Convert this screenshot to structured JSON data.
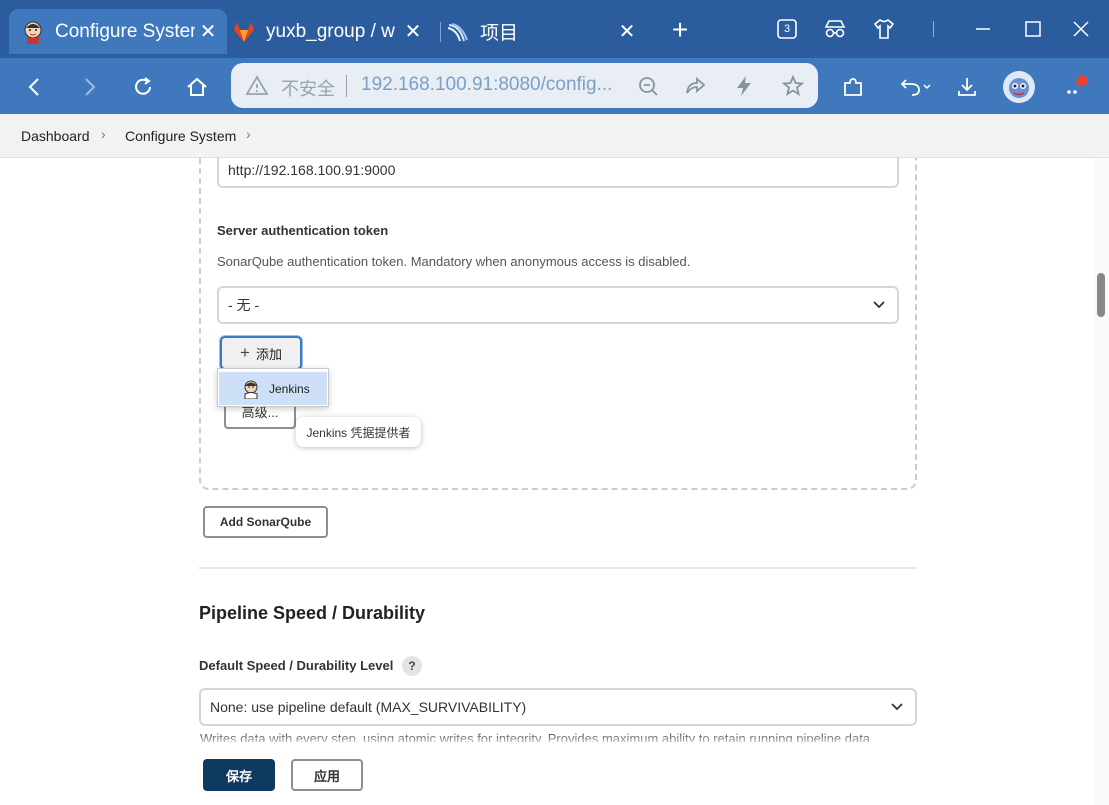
{
  "browser": {
    "tabs": [
      {
        "title": "Configure System",
        "icon": "jenkins-icon"
      },
      {
        "title": "yuxb_group / w",
        "icon": "gitlab-icon"
      },
      {
        "title": "项目",
        "icon": "project-icon"
      }
    ],
    "tab_count_badge": "3",
    "address": {
      "insecure_label": "不安全",
      "url": "192.168.100.91:8080/config..."
    }
  },
  "breadcrumb": {
    "items": [
      "Dashboard",
      "Configure System"
    ]
  },
  "sonar": {
    "server_url_value": "http://192.168.100.91:9000",
    "token_label": "Server authentication token",
    "token_desc": "SonarQube authentication token. Mandatory when anonymous access is disabled.",
    "token_select_value": "- 无 -",
    "add_button": "添加",
    "add_menu_item": "Jenkins",
    "advanced_button": "高级...",
    "tooltip": "Jenkins 凭据提供者",
    "add_sonarqube_button": "Add SonarQube"
  },
  "pipeline": {
    "heading": "Pipeline Speed / Durability",
    "level_label": "Default Speed / Durability Level",
    "help": "?",
    "level_value": "None: use pipeline default (MAX_SURVIVABILITY)",
    "level_desc": "Writes data with every step, using atomic writes for integrity.  Provides maximum ability to retain running pipeline data"
  },
  "footer": {
    "save": "保存",
    "apply": "应用"
  },
  "colors": {
    "tabstrip": "#2b5d9e",
    "toolbar": "#3f78bd",
    "save_button": "#0f3a5f"
  }
}
